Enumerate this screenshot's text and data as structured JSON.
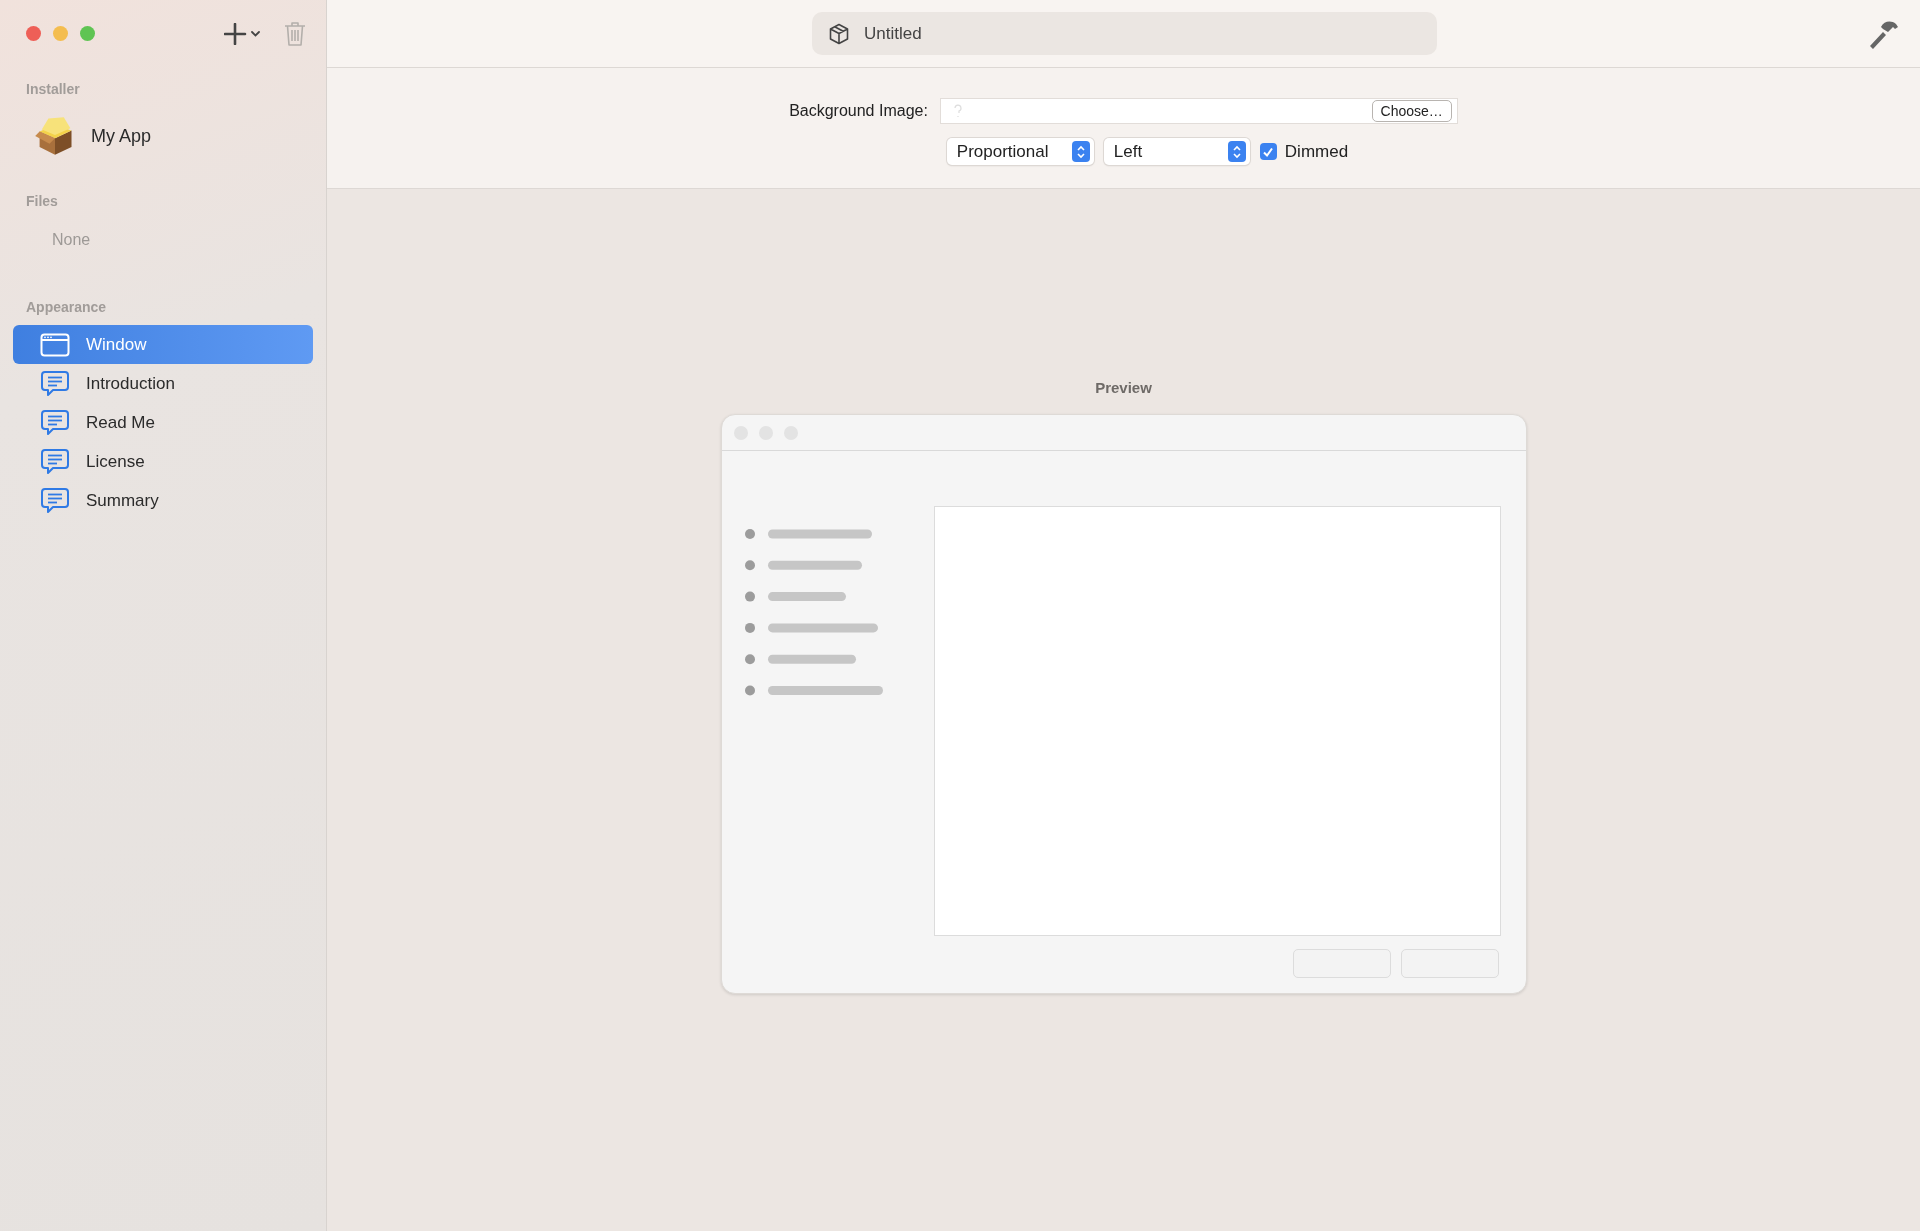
{
  "window": {
    "title": "Untitled"
  },
  "sidebar": {
    "sections": [
      {
        "heading": "Installer",
        "items": [
          {
            "label": "My App",
            "kind": "package",
            "selected": false
          }
        ]
      },
      {
        "heading": "Files",
        "empty_text": "None"
      },
      {
        "heading": "Appearance",
        "items": [
          {
            "label": "Window",
            "kind": "window",
            "selected": true
          },
          {
            "label": "Introduction",
            "kind": "text",
            "selected": false
          },
          {
            "label": "Read Me",
            "kind": "text",
            "selected": false
          },
          {
            "label": "License",
            "kind": "text",
            "selected": false
          },
          {
            "label": "Summary",
            "kind": "text",
            "selected": false
          }
        ]
      }
    ]
  },
  "settings": {
    "background_label": "Background Image:",
    "choose_button": "Choose…",
    "scaling": "Proportional",
    "alignment": "Left",
    "dimmed": {
      "label": "Dimmed",
      "checked": true
    }
  },
  "preview": {
    "title": "Preview"
  }
}
